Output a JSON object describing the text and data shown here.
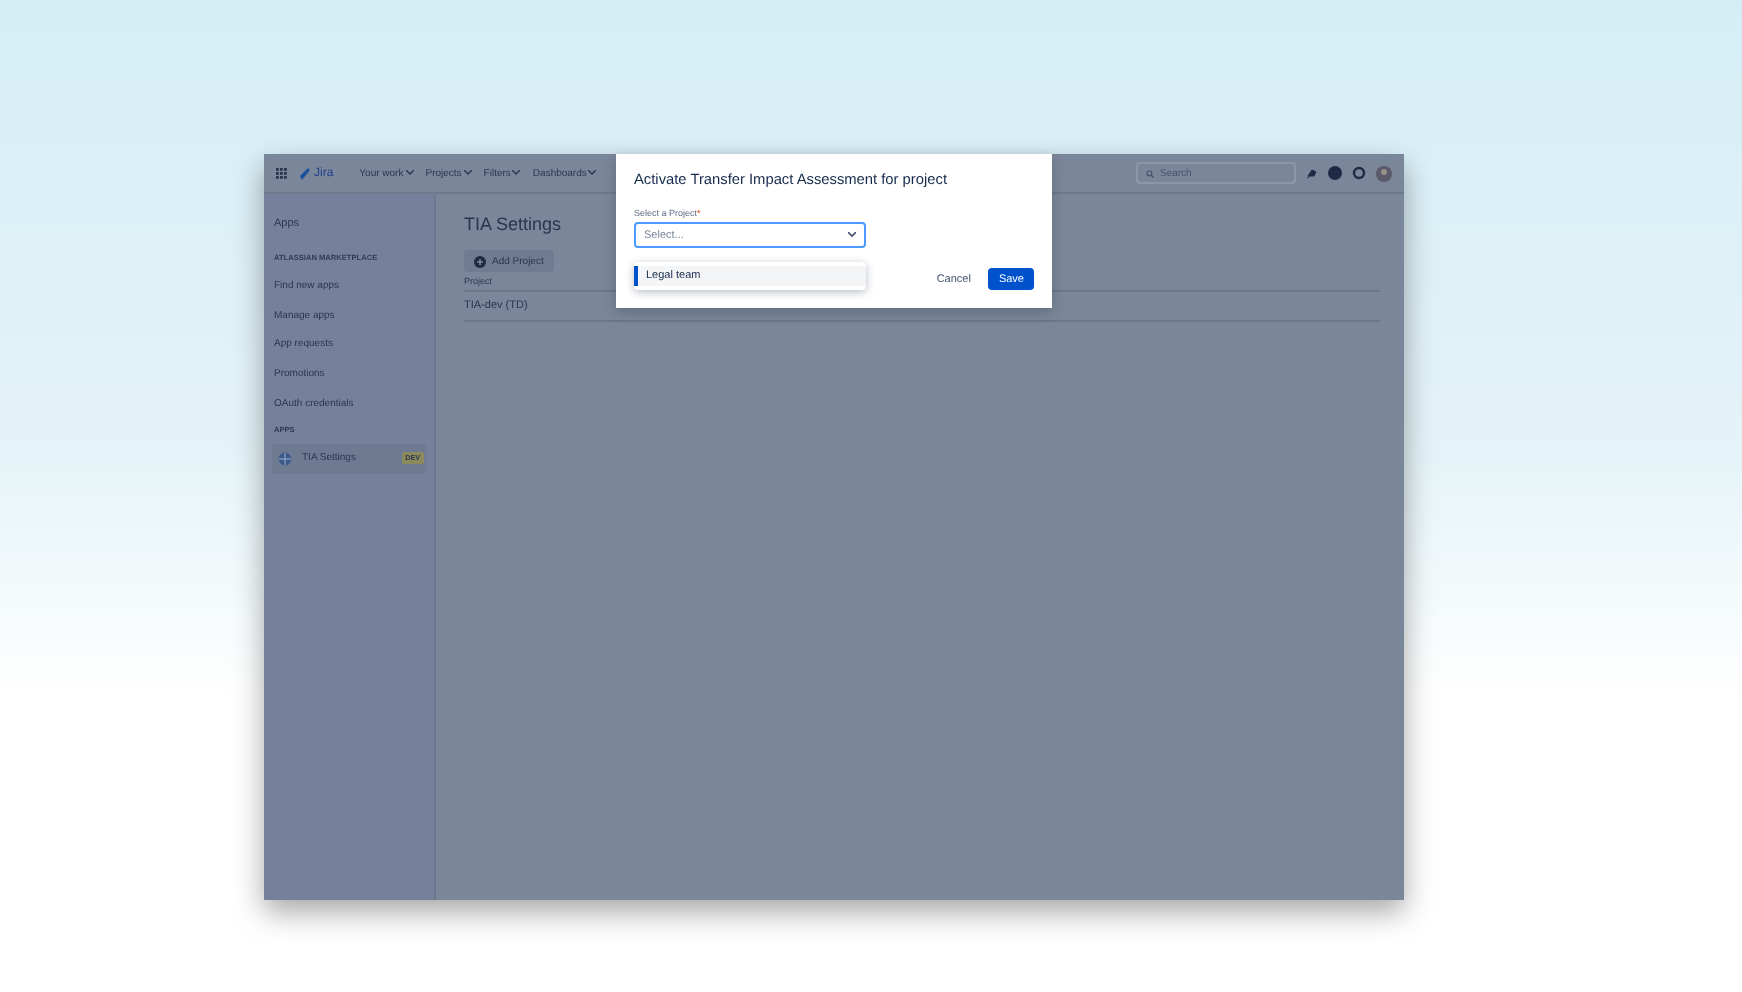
{
  "topbar": {
    "logo": "Jira",
    "nav": [
      {
        "label": "Your work"
      },
      {
        "label": "Projects"
      },
      {
        "label": "Filters"
      },
      {
        "label": "Dashboards"
      }
    ],
    "search": {
      "placeholder": "Search"
    }
  },
  "sidebar": {
    "heading": "Apps",
    "sections": [
      {
        "title": "ATLASSIAN MARKETPLACE",
        "items": [
          {
            "label": "Find new apps",
            "selected": false
          },
          {
            "label": "Manage apps",
            "selected": false
          },
          {
            "label": "App requests",
            "selected": false
          },
          {
            "label": "Promotions",
            "selected": false
          },
          {
            "label": "OAuth credentials",
            "selected": false
          }
        ]
      },
      {
        "title": "APPS",
        "items": [
          {
            "label": "TIA Settings",
            "badge": "DEV",
            "selected": true
          }
        ]
      }
    ]
  },
  "main": {
    "title": "TIA Settings",
    "add_button": "Add Project",
    "table": {
      "columns": [
        "Project"
      ],
      "rows": [
        [
          "TIA-dev (TD)"
        ]
      ]
    }
  },
  "modal": {
    "title": "Activate Transfer Impact Assessment for project",
    "field_label": "Select a Project",
    "required_mark": "*",
    "select": {
      "placeholder": "Select..."
    },
    "options": [
      {
        "label": "Legal team",
        "selected": true
      }
    ],
    "buttons": [
      {
        "label": "Cancel",
        "kind": "subtle"
      },
      {
        "label": "Save",
        "kind": "primary"
      }
    ]
  }
}
